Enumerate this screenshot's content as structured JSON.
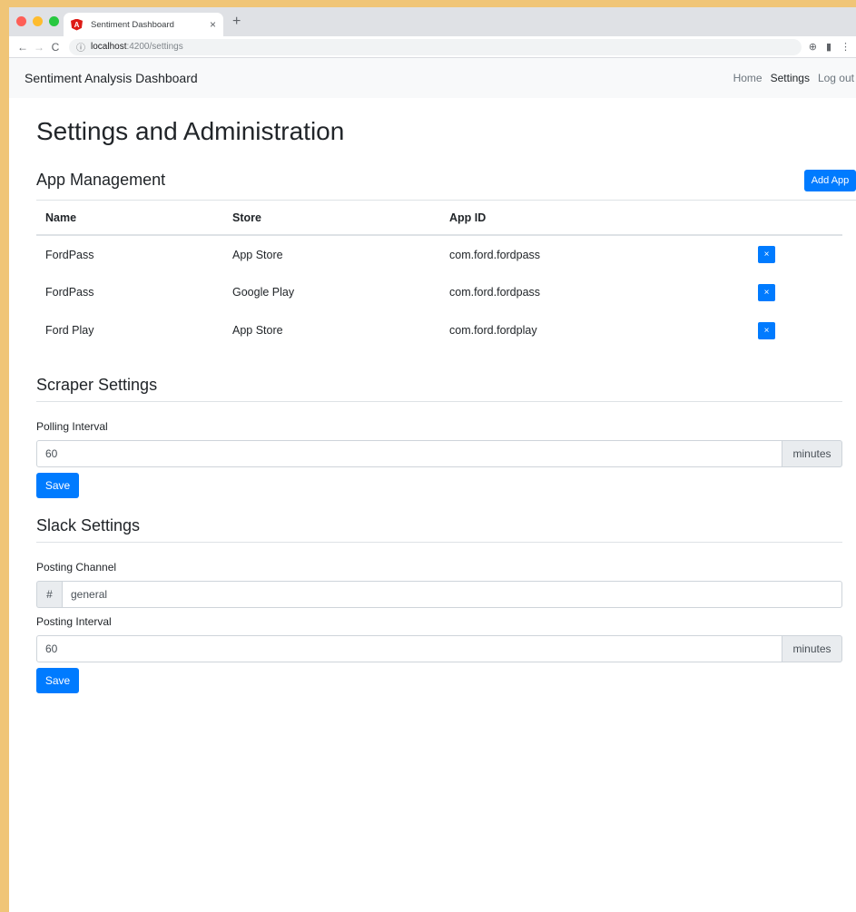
{
  "browser": {
    "tab_title": "Sentiment Dashboard",
    "tab_close": "×",
    "new_tab": "+",
    "url_host": "localhost",
    "url_path": ":4200/settings",
    "back": "←",
    "forward": "→",
    "reload": "C",
    "info": "ⓘ",
    "zoom_icon": "⊕",
    "ext_icon": "▮",
    "menu_icon": "⋮"
  },
  "navbar": {
    "brand": "Sentiment Analysis Dashboard",
    "links": [
      {
        "label": "Home",
        "active": false
      },
      {
        "label": "Settings",
        "active": true
      },
      {
        "label": "Log out",
        "active": false
      }
    ]
  },
  "page": {
    "title": "Settings and Administration"
  },
  "app_management": {
    "heading": "App Management",
    "add_button": "Add App",
    "columns": [
      "Name",
      "Store",
      "App ID"
    ],
    "rows": [
      {
        "name": "FordPass",
        "store": "App Store",
        "app_id": "com.ford.fordpass"
      },
      {
        "name": "FordPass",
        "store": "Google Play",
        "app_id": "com.ford.fordpass"
      },
      {
        "name": "Ford Play",
        "store": "App Store",
        "app_id": "com.ford.fordplay"
      }
    ],
    "delete_label": "×"
  },
  "scraper": {
    "heading": "Scraper Settings",
    "polling_label": "Polling Interval",
    "polling_value": "60",
    "polling_unit": "minutes",
    "save": "Save"
  },
  "slack": {
    "heading": "Slack Settings",
    "channel_label": "Posting Channel",
    "channel_prefix": "#",
    "channel_value": "general",
    "interval_label": "Posting Interval",
    "interval_value": "60",
    "interval_unit": "minutes",
    "save": "Save"
  },
  "colors": {
    "primary": "#007bff",
    "navbar_bg": "#f8f9fa",
    "frame": "#f0c577"
  }
}
